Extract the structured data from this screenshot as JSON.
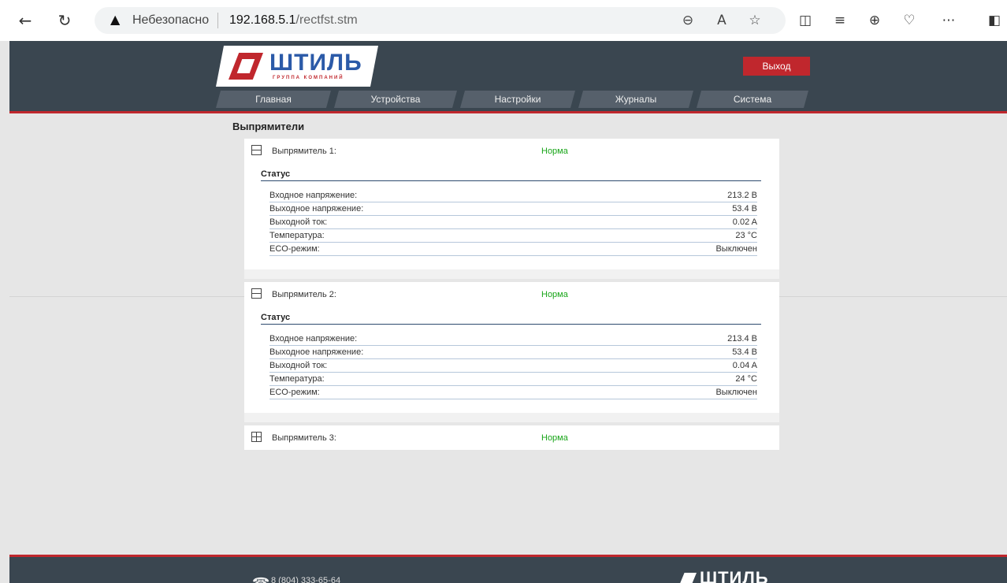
{
  "browser": {
    "security_label": "Небезопасно",
    "url_host": "192.168.5.1",
    "url_path": "/rectfst.stm",
    "icons": {
      "back": "arrow-left-icon",
      "refresh": "refresh-icon",
      "warning": "warning-icon",
      "zoom": "zoom-out-icon",
      "read_aloud": "read-aloud-icon",
      "favorite": "star-icon",
      "split": "split-screen-icon",
      "favorites_bar": "favorites-icon",
      "collections": "collections-icon",
      "performance": "heart-icon",
      "more": "more-icon",
      "sidebar": "sidebar-icon"
    }
  },
  "header": {
    "logo_name": "ШТИЛЬ",
    "logo_sub": "ГРУППА КОМПАНИЙ",
    "exit_label": "Выход",
    "nav": [
      "Главная",
      "Устройства",
      "Настройки",
      "Журналы",
      "Система"
    ]
  },
  "page": {
    "title": "Выпрямители"
  },
  "rectifiers": [
    {
      "name": "Выпрямитель 1:",
      "state": "Норма",
      "section": "Статус",
      "rows": [
        {
          "label": "Входное напряжение:",
          "value": "213.2 В"
        },
        {
          "label": "Выходное напряжение:",
          "value": "53.4 В"
        },
        {
          "label": "Выходной ток:",
          "value": "0.02 A"
        },
        {
          "label": "Температура:",
          "value": "23 °C"
        },
        {
          "label": "ECO-режим:",
          "value": "Выключен"
        }
      ]
    },
    {
      "name": "Выпрямитель 2:",
      "state": "Норма",
      "section": "Статус",
      "rows": [
        {
          "label": "Входное напряжение:",
          "value": "213.4 В"
        },
        {
          "label": "Выходное напряжение:",
          "value": "53.4 В"
        },
        {
          "label": "Выходной ток:",
          "value": "0.04 A"
        },
        {
          "label": "Температура:",
          "value": "24 °C"
        },
        {
          "label": "ECO-режим:",
          "value": "Выключен"
        }
      ]
    },
    {
      "name": "Выпрямитель 3:",
      "state": "Норма"
    }
  ],
  "footer": {
    "phone": "8 (804) 333-65-64",
    "logo_name": "ШТИЛЬ"
  },
  "colors": {
    "header_bg": "#3a4650",
    "accent_red": "#c0272d",
    "status_ok": "#1aa61a"
  }
}
